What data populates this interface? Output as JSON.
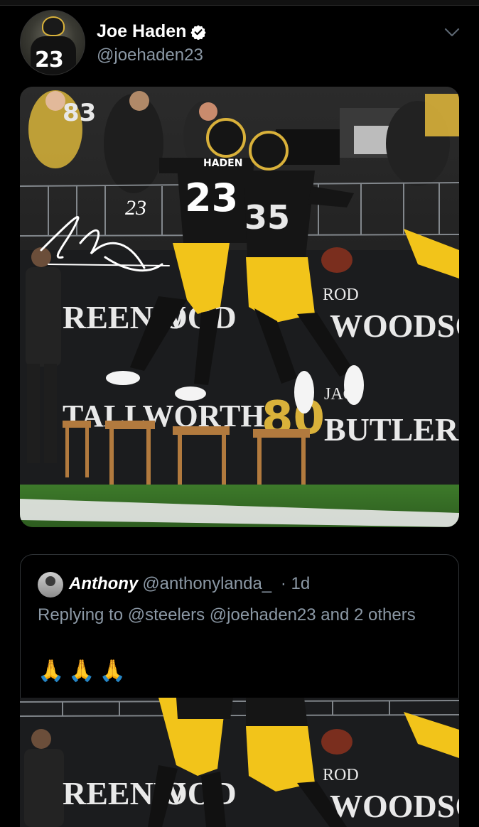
{
  "tweet": {
    "author_name": "Joe Haden",
    "author_handle": "@joehaden23",
    "avatar_number": "23",
    "media_alt": "Two Steelers players celebrating a mid-air chest bump"
  },
  "photo": {
    "signature_number": "23",
    "player_left_name": "HADEN",
    "player_left_number": "23",
    "player_right_number": "35",
    "wall_text_1": "REENW",
    "wall_text_2": "OOD",
    "wall_rod": "ROD",
    "wall_woodson": "WOODSO",
    "wall_text_3": "TALLWORTH",
    "wall_jack": "JAC",
    "wall_butler": "BUTLER",
    "wall_number": "80",
    "fan_number": "83"
  },
  "quoted": {
    "name": "Anthony",
    "handle": "@anthonylanda_",
    "time": "· 1d",
    "reply_text": "Replying to @steelers @joehaden23 and 2 others",
    "emoji": "🙏🙏🙏"
  },
  "colors": {
    "background": "#000000",
    "secondary_text": "#8b98a5",
    "steelers_gold": "#f2c41a",
    "verified_fill": "#ffffff"
  }
}
